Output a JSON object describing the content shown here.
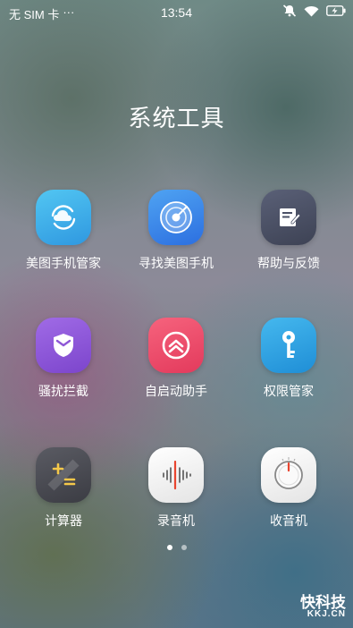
{
  "status_bar": {
    "carrier": "无 SIM 卡",
    "more": "···",
    "time": "13:54",
    "icons": [
      "mute-icon",
      "wifi-icon",
      "battery-charging-icon"
    ]
  },
  "folder": {
    "title": "系统工具"
  },
  "apps": [
    {
      "label": "美图手机管家",
      "icon": "cloud-sync-icon",
      "color": "#3fb0e8"
    },
    {
      "label": "寻找美图手机",
      "icon": "radar-icon",
      "color": "#3c86e6"
    },
    {
      "label": "帮助与反馈",
      "icon": "feedback-icon",
      "color": "#4a5066"
    },
    {
      "label": "骚扰拦截",
      "icon": "shield-icon",
      "color": "#8e57d6"
    },
    {
      "label": "自启动助手",
      "icon": "startup-icon",
      "color": "#f04a6a"
    },
    {
      "label": "权限管家",
      "icon": "key-icon",
      "color": "#2ea3e0"
    },
    {
      "label": "计算器",
      "icon": "calculator-icon",
      "color": "#4a4b52"
    },
    {
      "label": "录音机",
      "icon": "sound-wave-icon",
      "color": "#f2f2f2"
    },
    {
      "label": "收音机",
      "icon": "radio-dial-icon",
      "color": "#f2f2f2"
    }
  ],
  "page_indicator": {
    "pages": 2,
    "current": 1
  },
  "watermark": {
    "main": "快科技",
    "sub": "KKJ.CN"
  }
}
